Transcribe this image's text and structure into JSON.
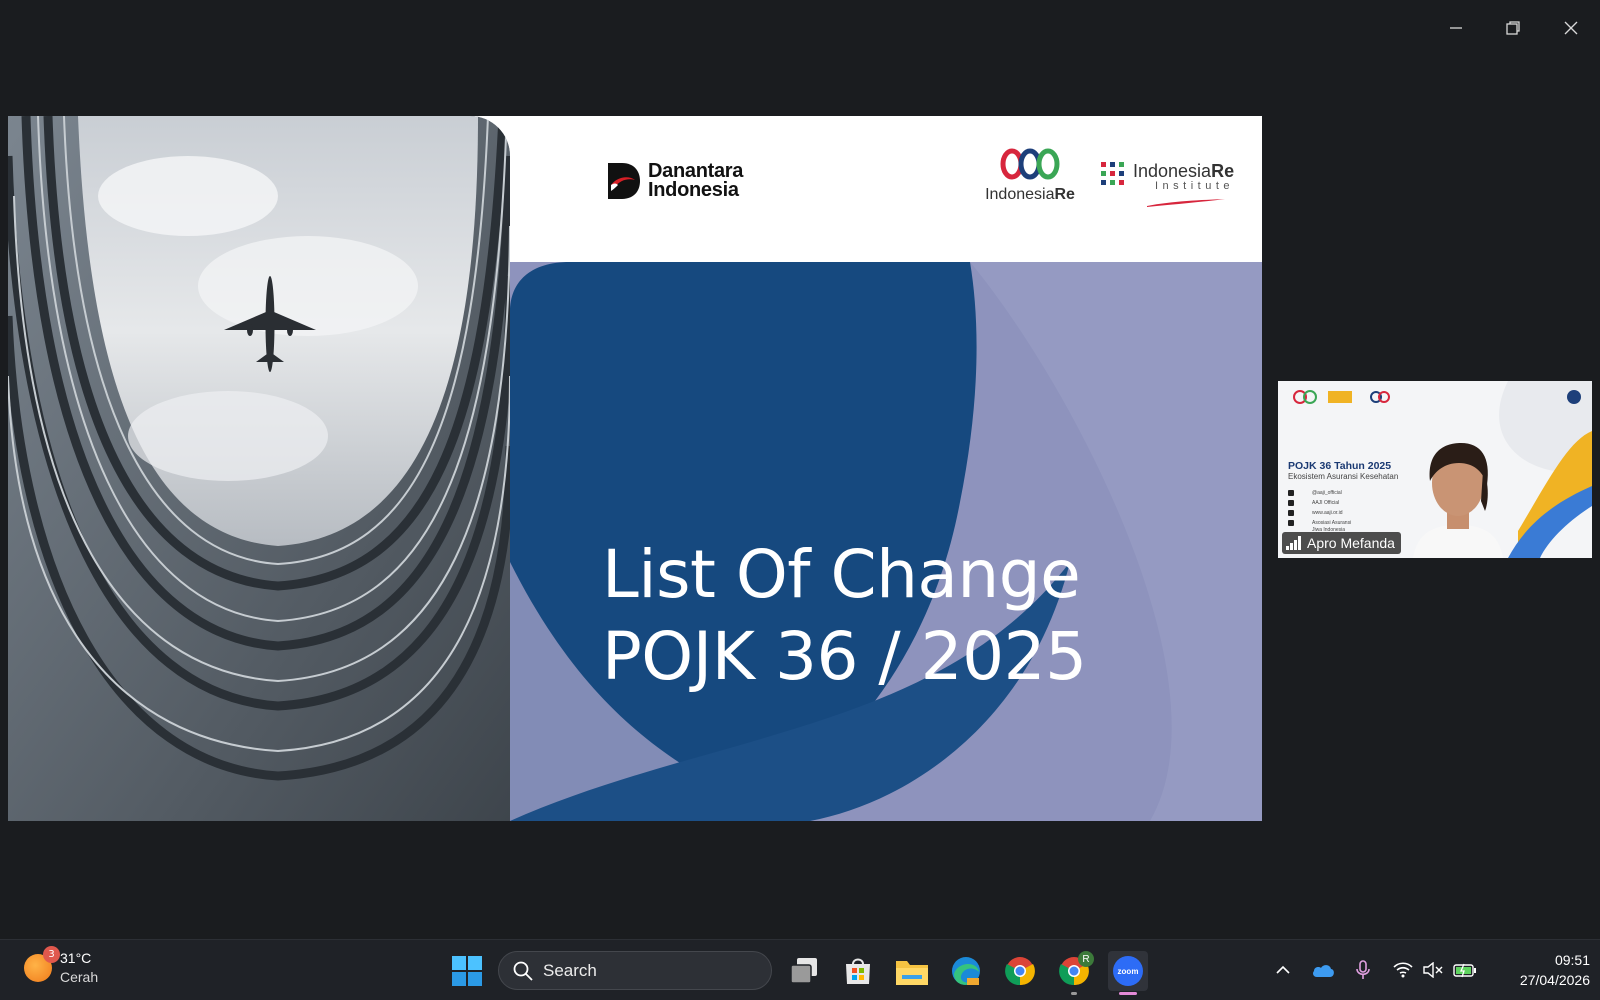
{
  "window": {
    "minimize_icon": "minimize-icon",
    "restore_icon": "restore-icon",
    "close_icon": "close-icon"
  },
  "slide": {
    "title_line1": "List Of Change",
    "title_line2": "POJK 36 / 2025",
    "logos": {
      "danantara_line1": "Danantara",
      "danantara_line2": "Indonesia",
      "indre_prefix": "Indonesia",
      "indre_suffix": "Re",
      "institute_prefix": "Indonesia",
      "institute_suffix": "Re",
      "institute_sub": "Institute"
    },
    "colors": {
      "blue_dark": "#16497f",
      "blue_light": "#8e93bd"
    }
  },
  "participant": {
    "name": "Apro Mefanda",
    "background_title": "POJK 36 Tahun 2025",
    "background_subtitle": "Ekosistem Asuransi Kesehatan",
    "rows": [
      "@aaji_official",
      "AAJI Official",
      "www.aaji.or.id",
      "Asosiasi Asuransi",
      "Jiwa Indonesia"
    ]
  },
  "taskbar": {
    "weather_temp": "31°C",
    "weather_condition": "Cerah",
    "weather_badge": "3",
    "search_label": "Search",
    "chrome_profile_badge": "R",
    "zoom_label": "zoom",
    "clock_time": "09:51",
    "clock_date": "27/04/2026"
  }
}
